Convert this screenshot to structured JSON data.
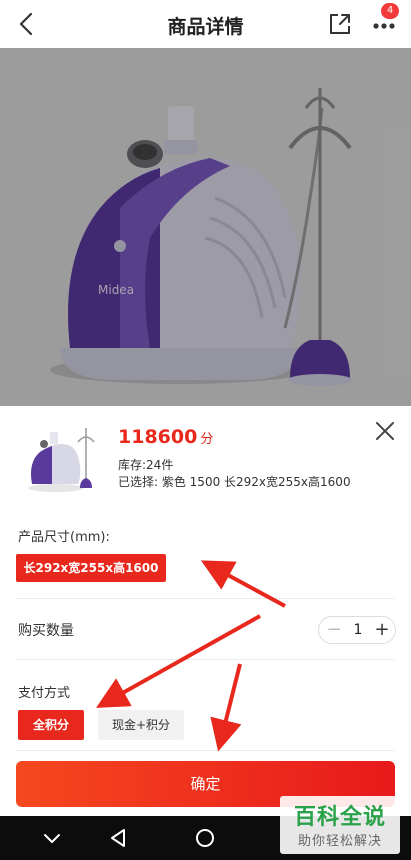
{
  "header": {
    "title": "商品详情",
    "badge_count": "4"
  },
  "product": {
    "price": "118600",
    "price_unit": "分",
    "stock": "库存:24件",
    "selected": "已选择:   紫色 1500 长292x宽255x高1600",
    "brand": "Midea"
  },
  "size_section": {
    "label": "产品尺寸(mm):",
    "option": "长292x宽255x高1600"
  },
  "quantity_section": {
    "label": "购买数量",
    "minus": "−",
    "value": "1",
    "plus": "+"
  },
  "payment_section": {
    "label": "支付方式",
    "options": [
      "全积分",
      "现金+积分"
    ]
  },
  "confirm_label": "确定",
  "watermark": {
    "top": "百科全说",
    "bottom": "助你轻松解决"
  },
  "colors": {
    "accent": "#e8281c",
    "product_purple": "#5b3a9e",
    "watermark_green": "#2aa24a"
  }
}
